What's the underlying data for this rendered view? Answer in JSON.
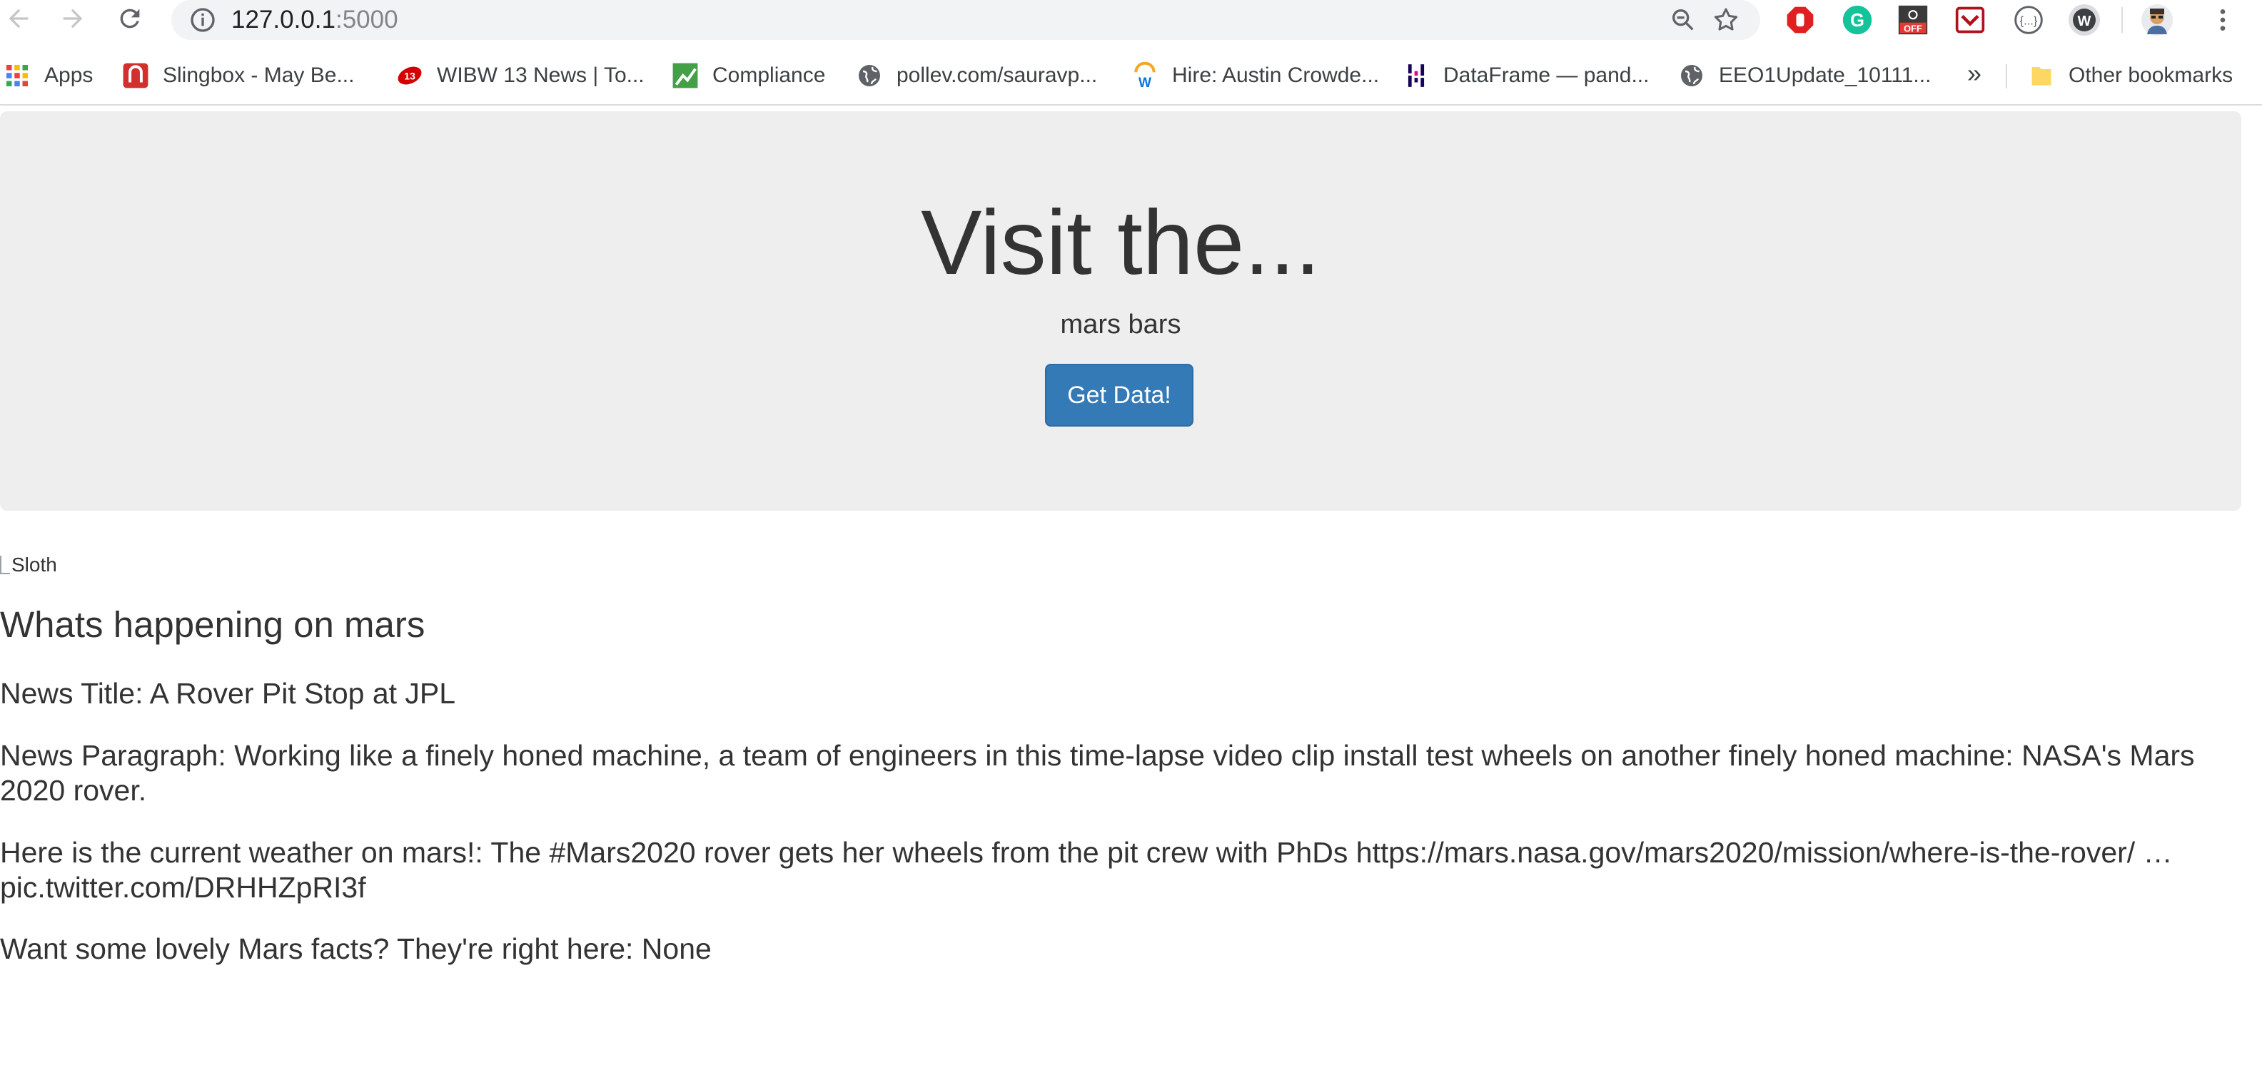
{
  "browser": {
    "url_host": "127.0.0.1",
    "url_port": ":5000",
    "bookmarks": [
      {
        "label": "Apps",
        "icon": "apps-grid-icon"
      },
      {
        "label": "Slingbox - May Be...",
        "icon": "slingbox-icon"
      },
      {
        "label": "WIBW 13 News | To...",
        "icon": "wibw-icon"
      },
      {
        "label": "Compliance",
        "icon": "compliance-icon"
      },
      {
        "label": "pollev.com/sauravp...",
        "icon": "globe-icon"
      },
      {
        "label": "Hire: Austin Crowde...",
        "icon": "workday-icon"
      },
      {
        "label": "DataFrame — pand...",
        "icon": "pandas-icon"
      },
      {
        "label": "EEO1Update_10111...",
        "icon": "globe-icon"
      }
    ],
    "more_bookmarks": "»",
    "other_bookmarks": "Other bookmarks"
  },
  "jumbotron": {
    "title": "Visit the...",
    "subtitle": "mars bars",
    "button_label": "Get Data!"
  },
  "image_alt": "Sloth",
  "content": {
    "heading": "Whats happening on mars",
    "news_title": "News Title: A Rover Pit Stop at JPL",
    "news_paragraph": "News Paragraph: Working like a finely honed machine, a team of engineers in this time-lapse video clip install test wheels on another finely honed machine: NASA's Mars 2020 rover.",
    "weather": "Here is the current weather on mars!: The #Mars2020 rover gets her wheels from the pit crew with PhDs https://mars.nasa.gov/mars2020/mission/where-is-the-rover/ …pic.twitter.com/DRHHZpRI3f",
    "facts": "Want some lovely Mars facts? They're right here: None"
  },
  "colors": {
    "jumbotron_bg": "#eeeeee",
    "button_bg": "#337ab7",
    "text": "#333333"
  }
}
